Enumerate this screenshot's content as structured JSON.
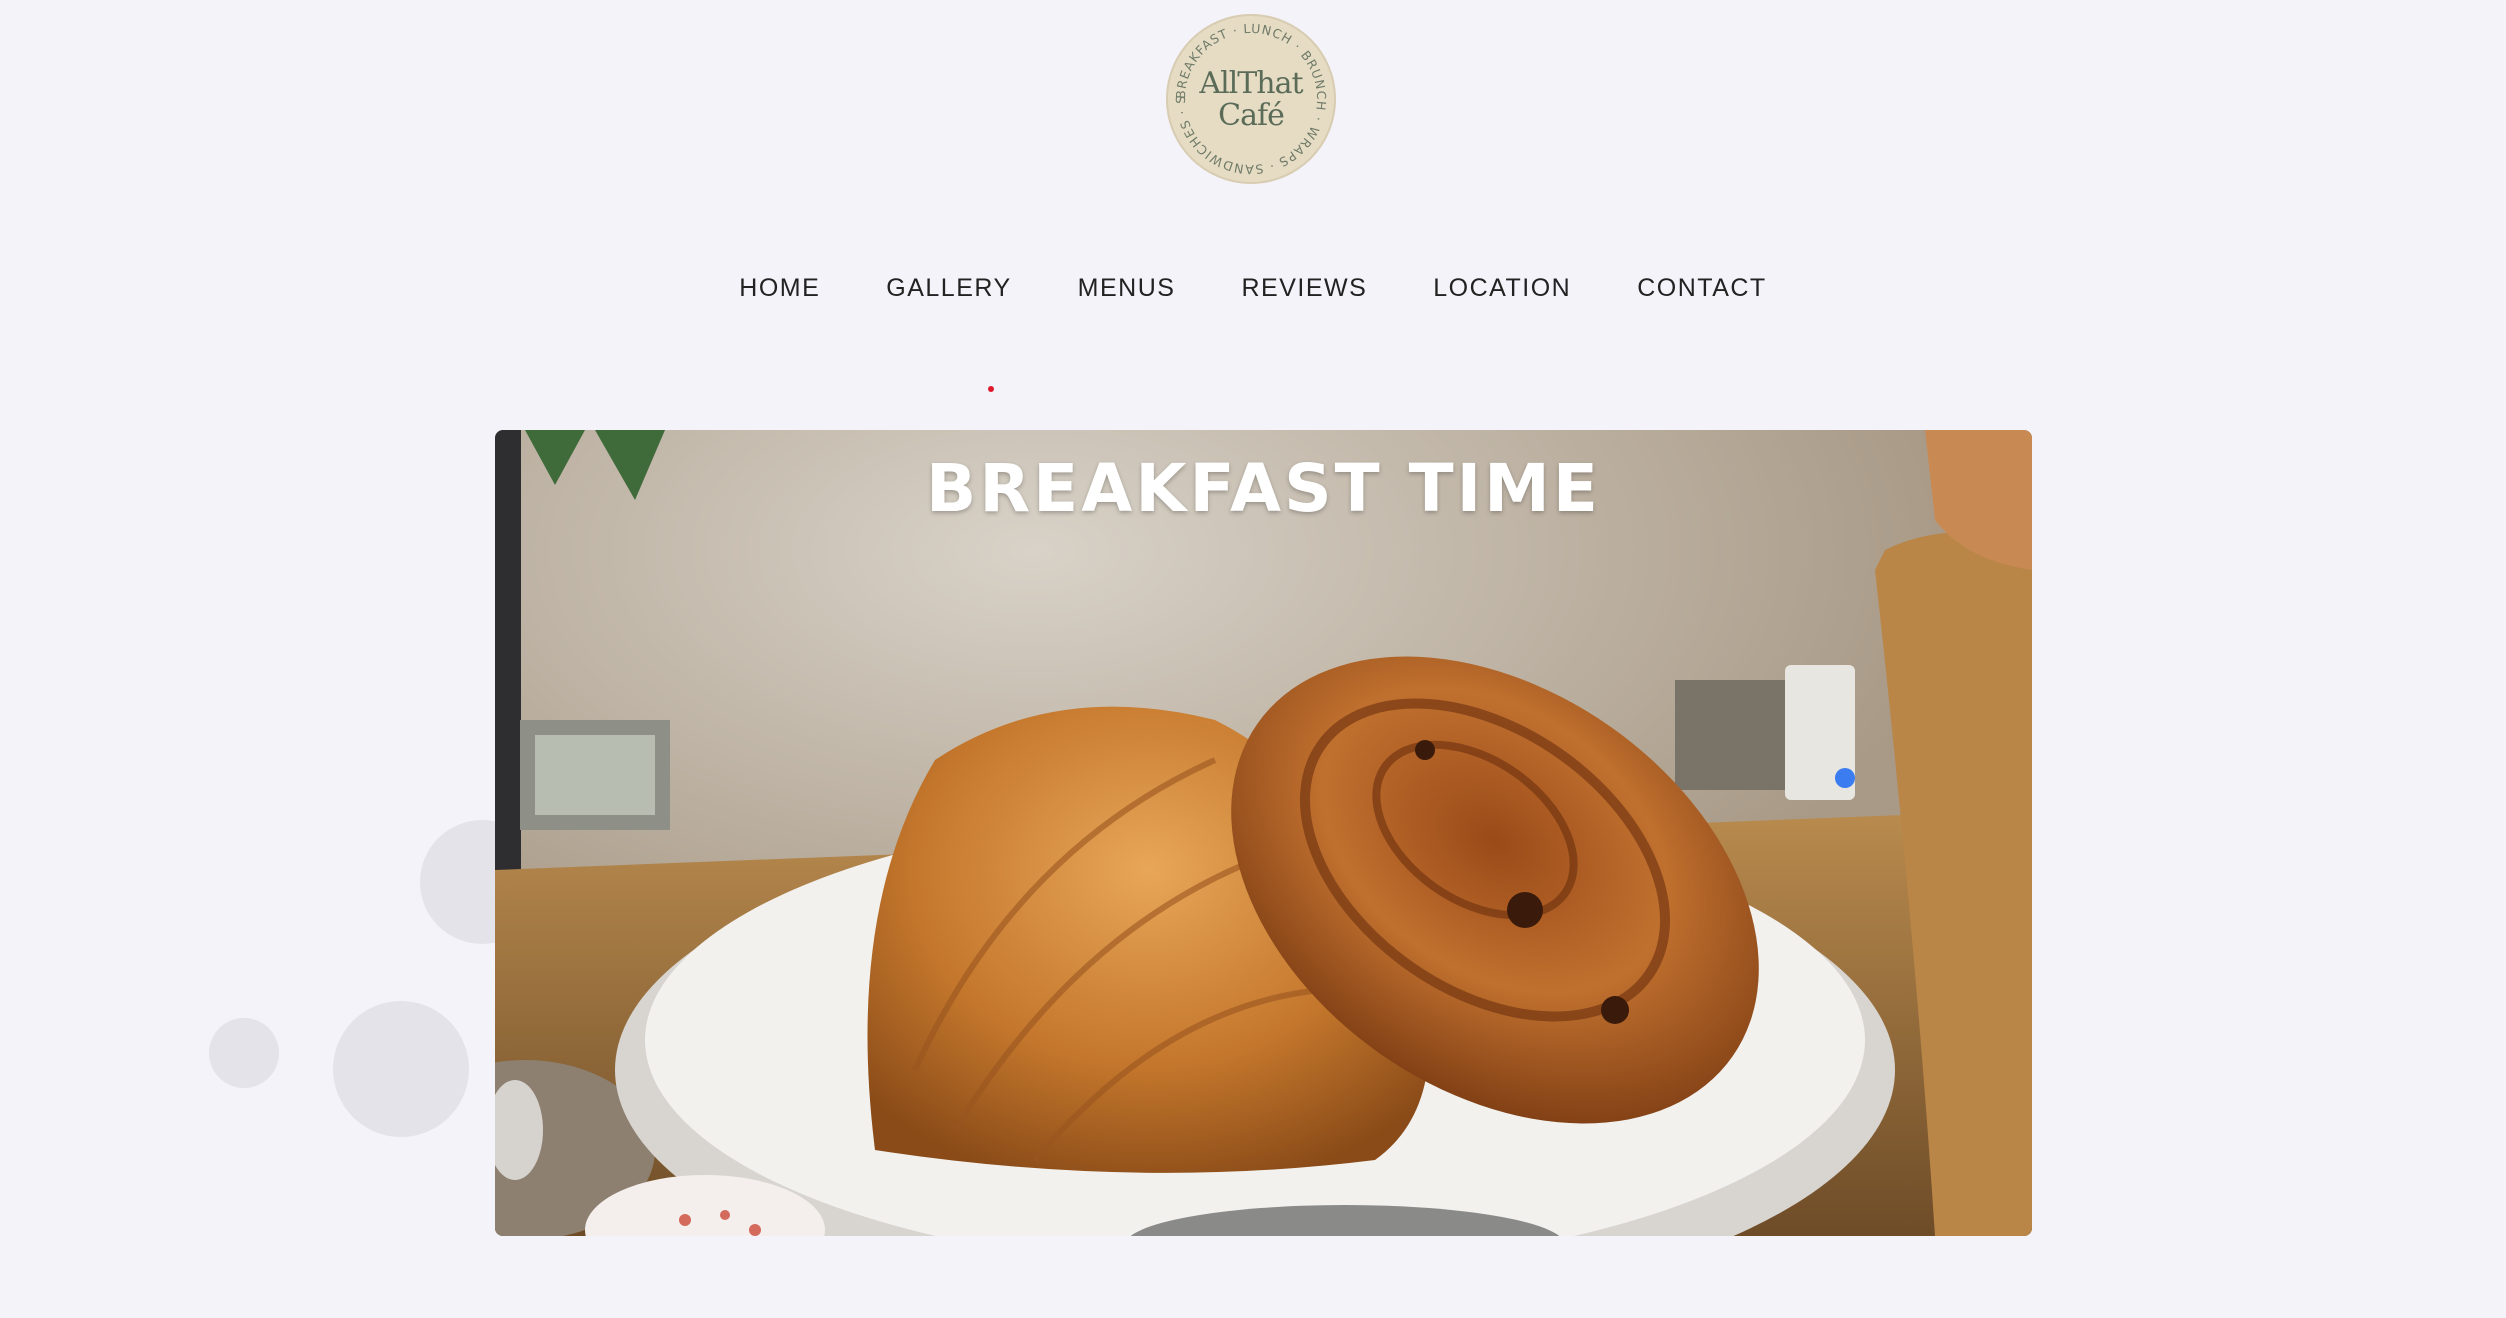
{
  "logo": {
    "ring_text": "BREAKFAST · LUNCH · BRUNCH · WRAPS · SANDWICHES · SALADS ·",
    "title_line1": "AllThat",
    "title_line2": "Café"
  },
  "nav": {
    "items": [
      {
        "label": "HOME"
      },
      {
        "label": "GALLERY"
      },
      {
        "label": "MENUS"
      },
      {
        "label": "REVIEWS"
      },
      {
        "label": "LOCATION"
      },
      {
        "label": "CONTACT"
      }
    ]
  },
  "hero": {
    "title": "BREAKFAST TIME"
  },
  "colors": {
    "background": "#f3f3f9",
    "logo_bg": "#e6dcc4",
    "logo_text": "#5a6b58",
    "accent_dot": "#e0182d"
  }
}
